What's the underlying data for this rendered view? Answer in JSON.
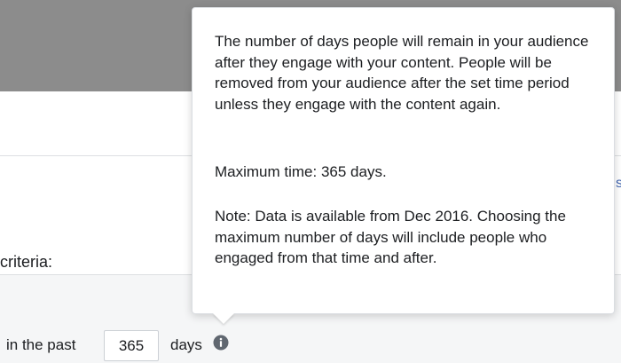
{
  "form": {
    "criteria_label": "criteria:",
    "retention": {
      "prefix": "in the past",
      "value": "365",
      "suffix": "days"
    }
  },
  "tooltip": {
    "description": "The number of days people will remain in your audience after they engage with your content. People will be removed from your audience after the set time period unless they engage with the content again.",
    "max_time": "Maximum time: 365 days.",
    "note": "Note: Data is available from Dec 2016. Choosing the maximum number of days will include people who engaged from that time and after."
  },
  "icons": {
    "info": "info-icon",
    "edge_glyph": "partially-visible-link-glyph"
  },
  "colors": {
    "top_bar": "#8c8c8c",
    "panel": "#ffffff",
    "divider": "#dddfe2",
    "text": "#1c1e21",
    "info_icon": "#606770",
    "link_blue": "#4267b2"
  }
}
